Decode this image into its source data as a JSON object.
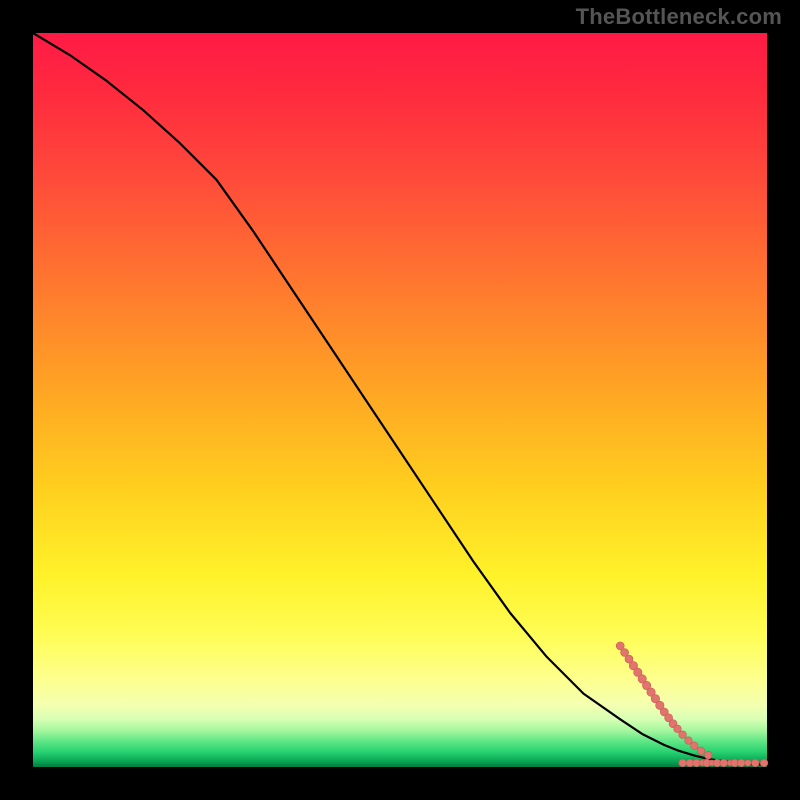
{
  "watermark": "TheBottleneck.com",
  "colors": {
    "marker": "#e2746e",
    "markerStroke": "#c85a55",
    "curve": "#000000"
  },
  "chart_data": {
    "type": "line",
    "title": "",
    "xlabel": "",
    "ylabel": "",
    "xlim": [
      0,
      100
    ],
    "ylim": [
      0,
      100
    ],
    "grid": false,
    "legend": false,
    "series": [
      {
        "name": "bottleneck-curve",
        "color": "#000000",
        "x": [
          0,
          5,
          10,
          15,
          20,
          25,
          30,
          35,
          40,
          45,
          50,
          55,
          60,
          65,
          70,
          75,
          80,
          83,
          86,
          88,
          90,
          92,
          94,
          96,
          98,
          100
        ],
        "values": [
          100,
          97,
          93.5,
          89.5,
          85,
          80,
          73,
          65.5,
          58,
          50.5,
          43,
          35.5,
          28,
          21,
          15,
          10,
          6.5,
          4.5,
          3.0,
          2.2,
          1.6,
          1.1,
          0.8,
          0.55,
          0.4,
          0.33
        ]
      }
    ],
    "scatter": {
      "name": "sample-markers",
      "color": "#e2746e",
      "points": [
        {
          "x": 80.0,
          "y": 16.5,
          "r": 4.0
        },
        {
          "x": 80.6,
          "y": 15.6,
          "r": 4.0
        },
        {
          "x": 81.2,
          "y": 14.7,
          "r": 4.0
        },
        {
          "x": 81.8,
          "y": 13.8,
          "r": 4.2
        },
        {
          "x": 82.4,
          "y": 12.9,
          "r": 4.2
        },
        {
          "x": 83.0,
          "y": 12.0,
          "r": 4.2
        },
        {
          "x": 83.6,
          "y": 11.1,
          "r": 4.2
        },
        {
          "x": 84.2,
          "y": 10.2,
          "r": 4.2
        },
        {
          "x": 84.8,
          "y": 9.3,
          "r": 4.2
        },
        {
          "x": 85.4,
          "y": 8.4,
          "r": 4.2
        },
        {
          "x": 86.0,
          "y": 7.5,
          "r": 4.0
        },
        {
          "x": 86.6,
          "y": 6.7,
          "r": 4.0
        },
        {
          "x": 87.2,
          "y": 5.9,
          "r": 4.0
        },
        {
          "x": 87.8,
          "y": 5.2,
          "r": 3.8
        },
        {
          "x": 88.5,
          "y": 4.4,
          "r": 3.8
        },
        {
          "x": 89.3,
          "y": 3.6,
          "r": 3.8
        },
        {
          "x": 90.1,
          "y": 2.9,
          "r": 3.8
        },
        {
          "x": 91.0,
          "y": 2.2,
          "r": 3.8
        },
        {
          "x": 92.0,
          "y": 1.6,
          "r": 3.8
        },
        {
          "x": 88.5,
          "y": 0.55,
          "r": 3.8
        },
        {
          "x": 89.5,
          "y": 0.55,
          "r": 3.8
        },
        {
          "x": 90.4,
          "y": 0.55,
          "r": 3.8
        },
        {
          "x": 91.2,
          "y": 0.55,
          "r": 3.0
        },
        {
          "x": 91.8,
          "y": 0.55,
          "r": 3.8
        },
        {
          "x": 92.5,
          "y": 0.55,
          "r": 3.0
        },
        {
          "x": 93.2,
          "y": 0.55,
          "r": 3.8
        },
        {
          "x": 94.1,
          "y": 0.55,
          "r": 3.8
        },
        {
          "x": 95.0,
          "y": 0.55,
          "r": 3.0
        },
        {
          "x": 95.6,
          "y": 0.55,
          "r": 3.8
        },
        {
          "x": 96.5,
          "y": 0.55,
          "r": 3.8
        },
        {
          "x": 97.4,
          "y": 0.55,
          "r": 3.2
        },
        {
          "x": 98.4,
          "y": 0.55,
          "r": 3.8
        },
        {
          "x": 99.6,
          "y": 0.55,
          "r": 3.8
        }
      ]
    }
  }
}
